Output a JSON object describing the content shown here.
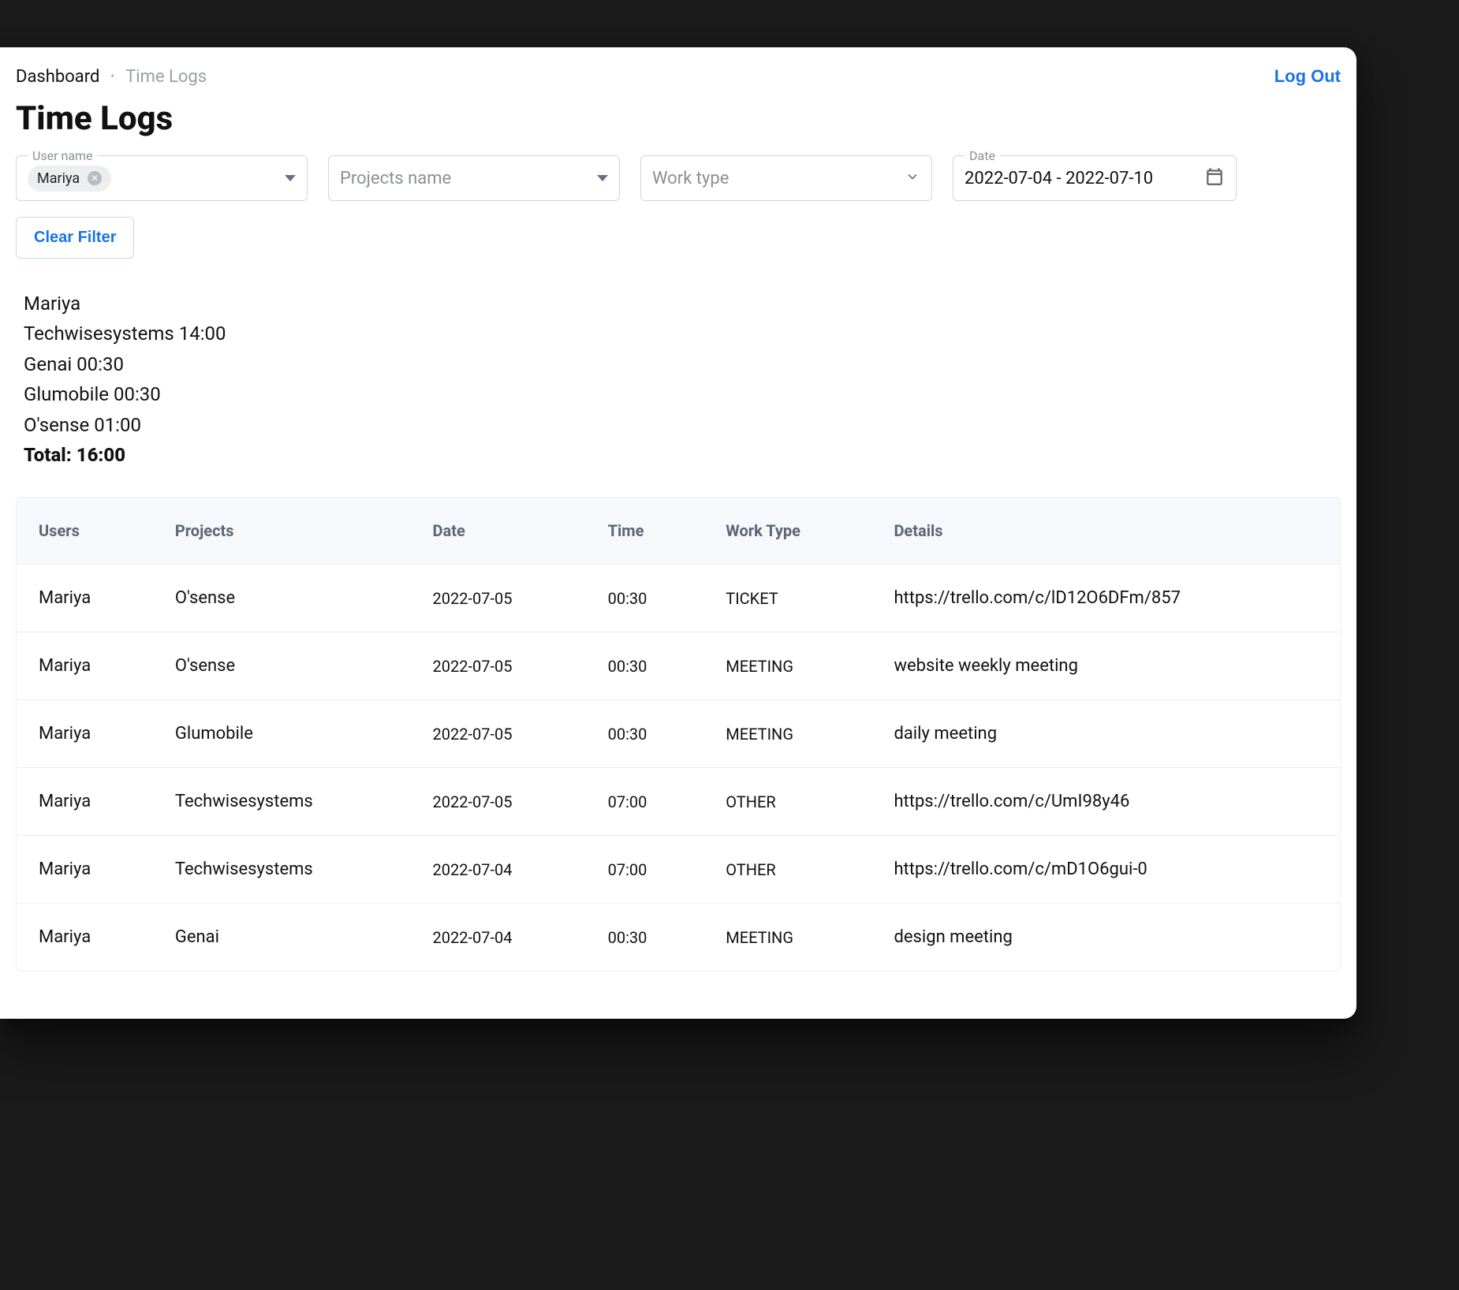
{
  "breadcrumb": {
    "root": "Dashboard",
    "leaf": "Time Logs"
  },
  "logout_label": "Log Out",
  "page_title": "Time Logs",
  "filters": {
    "user": {
      "label": "User name",
      "chip": "Mariya"
    },
    "projects": {
      "placeholder": "Projects name"
    },
    "worktype": {
      "placeholder": "Work type"
    },
    "date": {
      "label": "Date",
      "value": "2022-07-04 - 2022-07-10"
    }
  },
  "clear_filter_label": "Clear Filter",
  "summary": {
    "user": "Mariya",
    "lines": [
      "Techwisesystems 14:00",
      "Genai 00:30",
      "Glumobile 00:30",
      "O'sense 01:00"
    ],
    "total_label": "Total: 16:00"
  },
  "table": {
    "headers": [
      "Users",
      "Projects",
      "Date",
      "Time",
      "Work Type",
      "Details"
    ],
    "rows": [
      {
        "user": "Mariya",
        "project": "O'sense",
        "date": "2022-07-05",
        "time": "00:30",
        "type": "TICKET",
        "details": "https://trello.com/c/lD12O6DFm/857"
      },
      {
        "user": "Mariya",
        "project": "O'sense",
        "date": "2022-07-05",
        "time": "00:30",
        "type": "MEETING",
        "details": "website weekly meeting"
      },
      {
        "user": "Mariya",
        "project": "Glumobile",
        "date": "2022-07-05",
        "time": "00:30",
        "type": "MEETING",
        "details": "daily meeting"
      },
      {
        "user": "Mariya",
        "project": "Techwisesystems",
        "date": "2022-07-05",
        "time": "07:00",
        "type": "OTHER",
        "details": "https://trello.com/c/UmI98y46"
      },
      {
        "user": "Mariya",
        "project": "Techwisesystems",
        "date": "2022-07-04",
        "time": "07:00",
        "type": "OTHER",
        "details": "https://trello.com/c/mD1O6gui-0"
      },
      {
        "user": "Mariya",
        "project": "Genai",
        "date": "2022-07-04",
        "time": "00:30",
        "type": "MEETING",
        "details": "design meeting"
      }
    ]
  }
}
